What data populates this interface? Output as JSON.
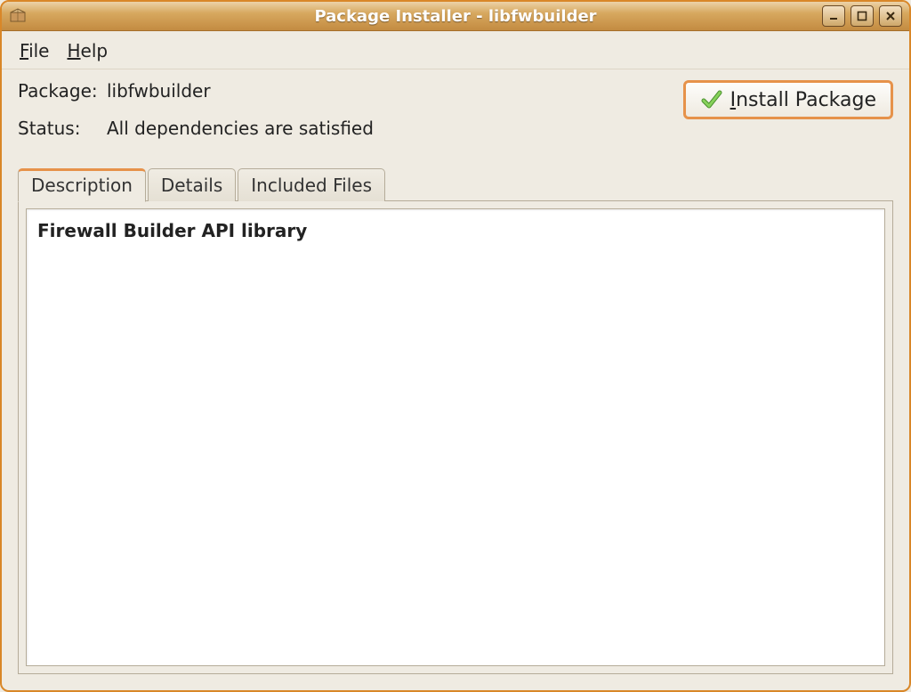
{
  "window": {
    "title": "Package Installer - libfwbuilder"
  },
  "menubar": {
    "file": "File",
    "help": "Help"
  },
  "info": {
    "package_label": "Package:",
    "package_value": "libfwbuilder",
    "status_label": "Status:",
    "status_value": "All dependencies are satisfied"
  },
  "actions": {
    "install_label": "nstall Package"
  },
  "tabs": {
    "description": "Description",
    "details": "Details",
    "included_files": "Included Files"
  },
  "description": {
    "summary": "Firewall Builder API library"
  },
  "icons": {
    "app": "package-icon",
    "check": "check-icon",
    "minimize": "minimize-icon",
    "maximize": "maximize-icon",
    "close": "close-icon"
  }
}
